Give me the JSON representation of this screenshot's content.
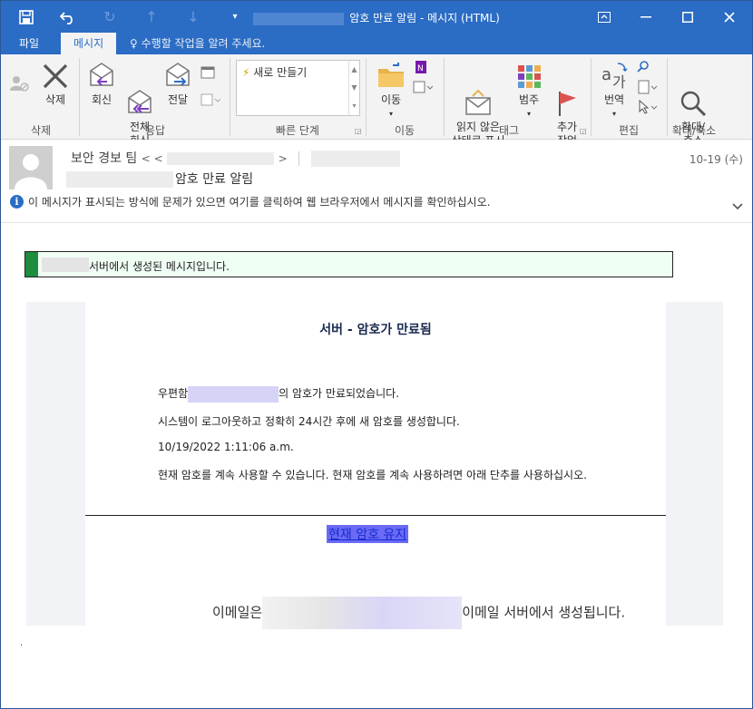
{
  "window": {
    "title": "암호 만료 알림 - 메시지 (HTML)"
  },
  "ribbon_tabs": [
    {
      "label": "파일"
    },
    {
      "label": "메시지"
    }
  ],
  "tell_me": "수행할 작업을 알려 주세요.",
  "ribbon": {
    "delete_label": "삭제",
    "reply_label": "회신",
    "reply_all_label": "전체\n회신",
    "forward_label": "전달",
    "quick_steps_item": "새로 만들기",
    "move_label": "이동",
    "mark_unread_label": "읽지 않은\n상태로 표시",
    "categorize_label": "범주",
    "followup_label": "추가\n작업",
    "translate_label": "번역",
    "zoom_label": "확대/\n축소",
    "groups": [
      "삭제",
      "응답",
      "빠른 단계",
      "이동",
      "태그",
      "편집",
      "확대/축소"
    ]
  },
  "header": {
    "sender": "보안 경보 팀",
    "date": "10-19 (수)",
    "subject": "암호 만료 알림",
    "infobar": "이 메시지가 표시되는 방식에 문제가 있으면 여기를 클릭하여 웹 브라우저에서 메시지를 확인하십시오."
  },
  "message": {
    "banner": "서버에서 생성된 메시지입니다.",
    "title": "서버 - 암호가 만료됨",
    "line1_prefix": "우편함",
    "line1_suffix": "의 암호가 만료되었습니다.",
    "line2": "시스템이 로그아웃하고 정확히 24시간 후에 새 암호를 생성합니다.",
    "timestamp": "10/19/2022 1:11:06 a.m.",
    "line3": "현재 암호를 계속 사용할 수 있습니다. 현재 암호를 계속 사용하려면 아래 단추를 사용하십시오.",
    "keep_button": "현재 암호 유지",
    "footer_prefix": "이메일은",
    "footer_suffix": "이메일 서버에서 생성됩니다."
  },
  "colors": {
    "titlebar": "#2b6cc4",
    "ribbon": "#f3f3f3",
    "banner_accent": "#1e8e3e"
  }
}
